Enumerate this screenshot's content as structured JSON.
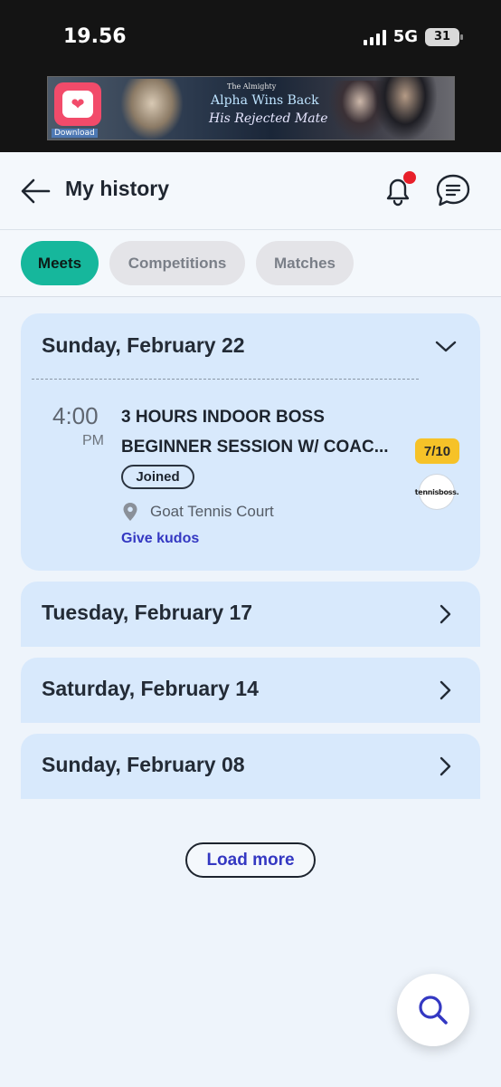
{
  "status_bar": {
    "time": "19.56",
    "network": "5G",
    "battery": "31"
  },
  "ad": {
    "download_label": "Download",
    "subtitle": "The Almighty",
    "title": "Alpha Wins Back",
    "tagline": "His Rejected Mate"
  },
  "header": {
    "title": "My history"
  },
  "tabs": [
    {
      "label": "Meets",
      "active": true
    },
    {
      "label": "Competitions",
      "active": false
    },
    {
      "label": "Matches",
      "active": false
    }
  ],
  "days": [
    {
      "date": "Sunday, February 22",
      "expanded": true,
      "events": [
        {
          "time": "4:00",
          "ampm": "PM",
          "title_line1": "3 HOURS INDOOR BOSS",
          "title_line2": "BEGINNER SESSION W/ COAC...",
          "capacity": "7/10",
          "status": "Joined",
          "club_logo_text": "tennisboss.",
          "location": "Goat Tennis Court",
          "action": "Give kudos"
        }
      ]
    },
    {
      "date": "Tuesday, February 17",
      "expanded": false
    },
    {
      "date": "Saturday, February 14",
      "expanded": false
    },
    {
      "date": "Sunday, February 08",
      "expanded": false
    }
  ],
  "load_more_label": "Load more",
  "colors": {
    "accent_green": "#16b79c",
    "card_blue": "#d8e9fc",
    "link_blue": "#3438c2",
    "badge_yellow": "#f6c228",
    "notification_red": "#e8202a"
  }
}
